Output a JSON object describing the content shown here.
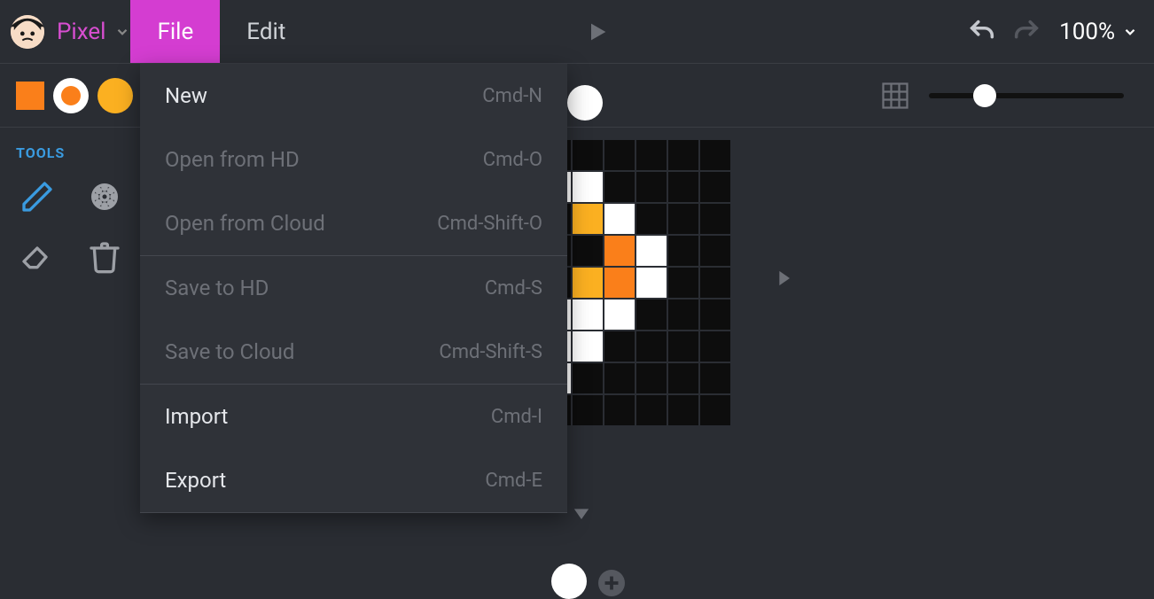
{
  "mode": {
    "label": "Pixel"
  },
  "menu": {
    "file": "File",
    "edit": "Edit"
  },
  "zoom": "100%",
  "sidebar": {
    "tools_label": "TOOLS"
  },
  "file_menu": {
    "items": [
      {
        "label": "New",
        "shortcut": "Cmd-N",
        "enabled": true
      },
      {
        "label": "Open from HD",
        "shortcut": "Cmd-O",
        "enabled": false
      },
      {
        "label": "Open from Cloud",
        "shortcut": "Cmd-Shift-O",
        "enabled": false
      },
      {
        "label": "Save to HD",
        "shortcut": "Cmd-S",
        "enabled": false
      },
      {
        "label": "Save to Cloud",
        "shortcut": "Cmd-Shift-S",
        "enabled": false
      },
      {
        "label": "Import",
        "shortcut": "Cmd-I",
        "enabled": true
      },
      {
        "label": "Export",
        "shortcut": "Cmd-E",
        "enabled": true
      }
    ]
  },
  "colors": {
    "primary": "#fa7f1a",
    "secondary": "#fbb021",
    "accent": "#d43dd1"
  },
  "pixel_canvas": {
    "cols": 11,
    "rows": 9,
    "cells": [
      "...........",
      ".....WW....",
      "......YW...",
      ".......OW..",
      "......YOW..",
      ".....WWW...",
      ".....WW....",
      ".....W.....",
      "..........."
    ],
    "legend": {
      ".": "black",
      "W": "white",
      "O": "orange",
      "Y": "yellow"
    }
  }
}
